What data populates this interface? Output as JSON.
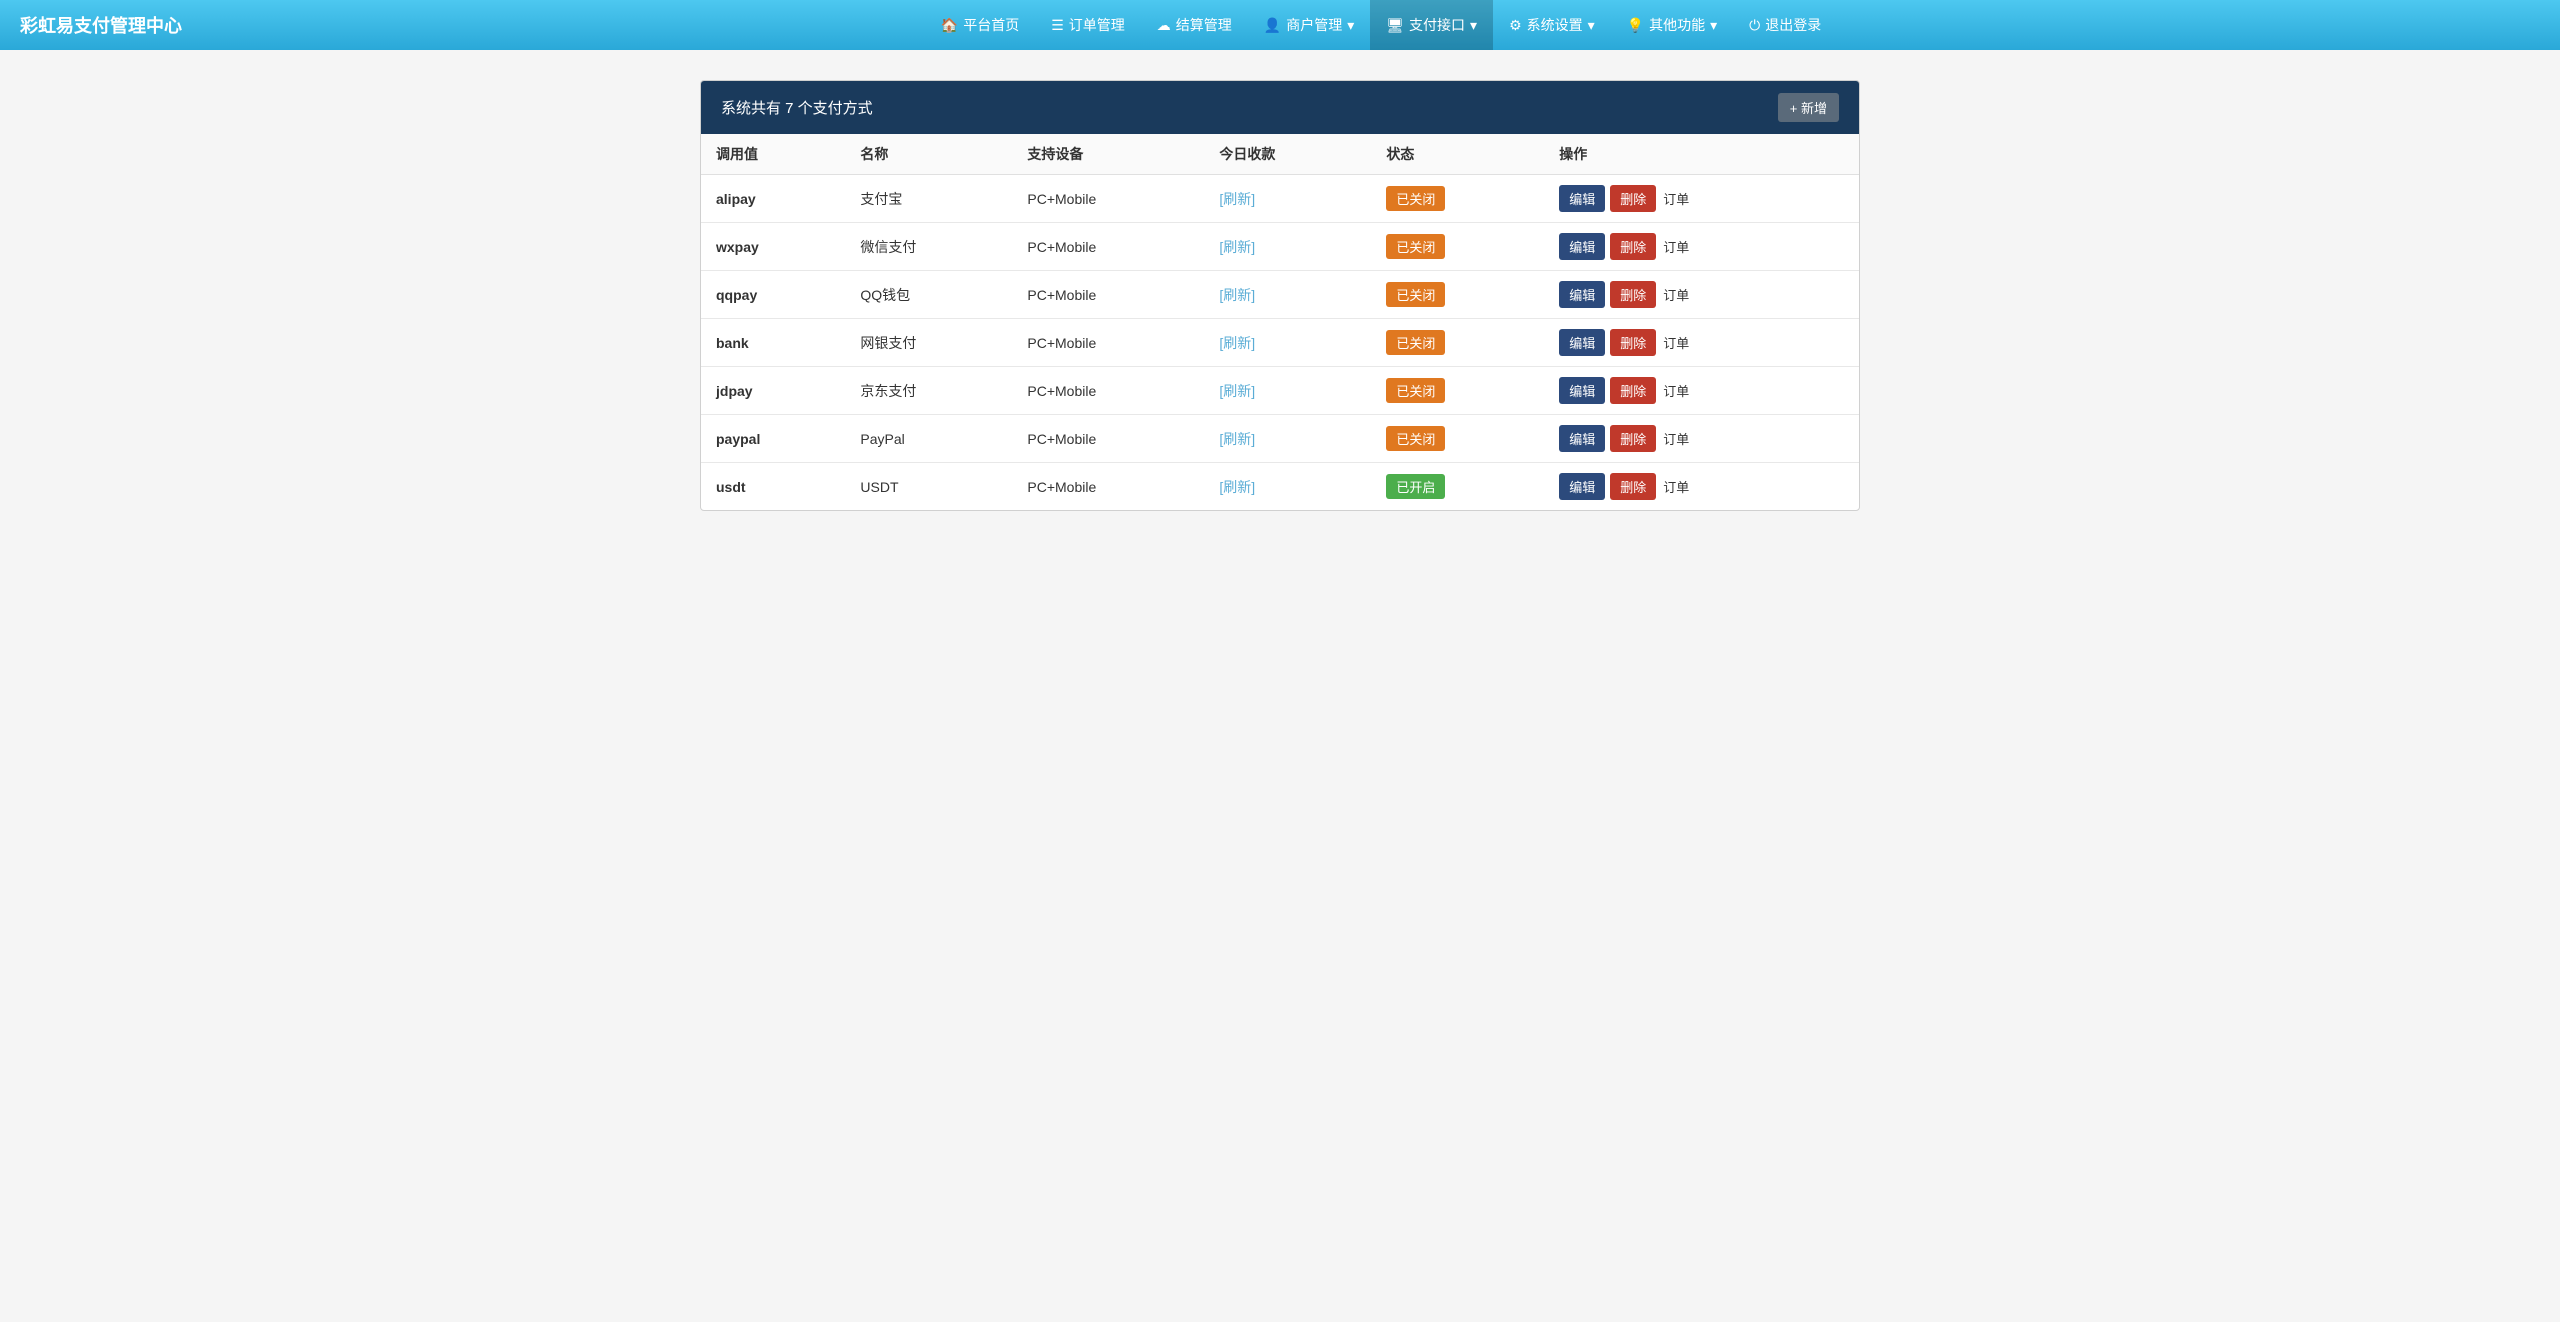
{
  "site": {
    "title": "彩虹易支付管理中心"
  },
  "navbar": {
    "brand": "彩虹易支付管理中心",
    "items": [
      {
        "id": "home",
        "label": "平台首页",
        "icon": "🏠",
        "active": false,
        "has_dropdown": false
      },
      {
        "id": "orders",
        "label": "订单管理",
        "icon": "📋",
        "active": false,
        "has_dropdown": false
      },
      {
        "id": "settlement",
        "label": "结算管理",
        "icon": "☁",
        "active": false,
        "has_dropdown": false
      },
      {
        "id": "merchant",
        "label": "商户管理",
        "icon": "👤",
        "active": false,
        "has_dropdown": true
      },
      {
        "id": "payment",
        "label": "支付接口",
        "icon": "🖥",
        "active": true,
        "has_dropdown": true
      },
      {
        "id": "settings",
        "label": "系统设置",
        "icon": "⚙",
        "active": false,
        "has_dropdown": true
      },
      {
        "id": "other",
        "label": "其他功能",
        "icon": "💡",
        "active": false,
        "has_dropdown": true
      },
      {
        "id": "logout",
        "label": "退出登录",
        "icon": "⏻",
        "active": false,
        "has_dropdown": false
      }
    ]
  },
  "table": {
    "header": "系统共有 7 个支付方式",
    "add_button": "+ 新增",
    "columns": [
      {
        "key": "key",
        "label": "调用值"
      },
      {
        "key": "name",
        "label": "名称"
      },
      {
        "key": "device",
        "label": "支持设备"
      },
      {
        "key": "today",
        "label": "今日收款"
      },
      {
        "key": "status",
        "label": "状态"
      },
      {
        "key": "action",
        "label": "操作"
      }
    ],
    "rows": [
      {
        "key": "alipay",
        "name": "支付宝",
        "device": "PC+Mobile",
        "today": "[刷新]",
        "status": "已关闭",
        "status_type": "closed"
      },
      {
        "key": "wxpay",
        "name": "微信支付",
        "device": "PC+Mobile",
        "today": "[刷新]",
        "status": "已关闭",
        "status_type": "closed"
      },
      {
        "key": "qqpay",
        "name": "QQ钱包",
        "device": "PC+Mobile",
        "today": "[刷新]",
        "status": "已关闭",
        "status_type": "closed"
      },
      {
        "key": "bank",
        "name": "网银支付",
        "device": "PC+Mobile",
        "today": "[刷新]",
        "status": "已关闭",
        "status_type": "closed"
      },
      {
        "key": "jdpay",
        "name": "京东支付",
        "device": "PC+Mobile",
        "today": "[刷新]",
        "status": "已关闭",
        "status_type": "closed"
      },
      {
        "key": "paypal",
        "name": "PayPal",
        "device": "PC+Mobile",
        "today": "[刷新]",
        "status": "已关闭",
        "status_type": "closed"
      },
      {
        "key": "usdt",
        "name": "USDT",
        "device": "PC+Mobile",
        "today": "[刷新]",
        "status": "已开启",
        "status_type": "open"
      }
    ],
    "action_labels": {
      "edit": "编辑",
      "delete": "删除",
      "order": "订单"
    }
  }
}
